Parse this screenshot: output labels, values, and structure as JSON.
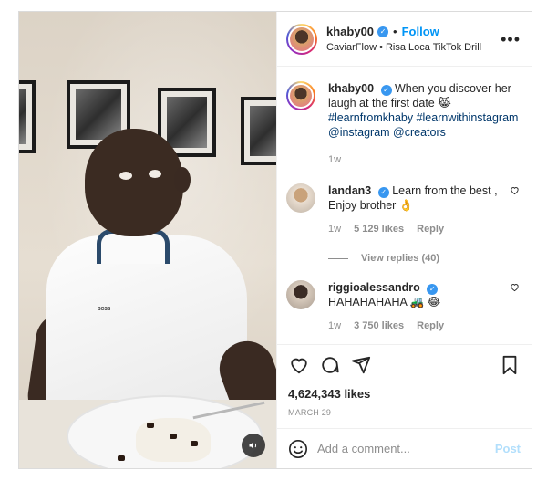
{
  "post": {
    "author": "khaby00",
    "follow_label": "Follow",
    "dot": "•",
    "audio": "CaviarFlow • Risa Loca TikTok Drill",
    "more_label": "•••",
    "caption": {
      "username": "khaby00",
      "text": "When you discover her laugh at the first date 😹",
      "hashtags": "#learnfromkhaby #learnwithinstagram",
      "mentions": "@instagram @creators",
      "time": "1w"
    },
    "comments": [
      {
        "username": "landan3",
        "text": "Learn from the best , Enjoy brother 👌",
        "time": "1w",
        "likes": "5 129 likes",
        "reply": "Reply"
      },
      {
        "username": "riggioalessandro",
        "text": "HAHAHAHAHA 🚜 😂",
        "time": "1w",
        "likes": "3 750 likes",
        "reply": "Reply"
      }
    ],
    "view_replies": "View replies (40)",
    "like_count": "4,624,343 likes",
    "date": "MARCH 29",
    "add_comment_placeholder": "Add a comment...",
    "post_button": "Post",
    "shirt_logo": "BOSS"
  },
  "colors": {
    "accent": "#0095f6",
    "verified": "#3897f0",
    "post_disabled": "#b2dffc",
    "link": "#00376b",
    "muted": "#8e8e8e"
  },
  "icons": {
    "verified": "verified-badge-icon",
    "more": "more-options-icon",
    "heart": "heart-icon",
    "comment": "comment-icon",
    "share": "share-icon",
    "save": "bookmark-icon",
    "emoji": "emoji-icon",
    "sound": "sound-icon"
  }
}
